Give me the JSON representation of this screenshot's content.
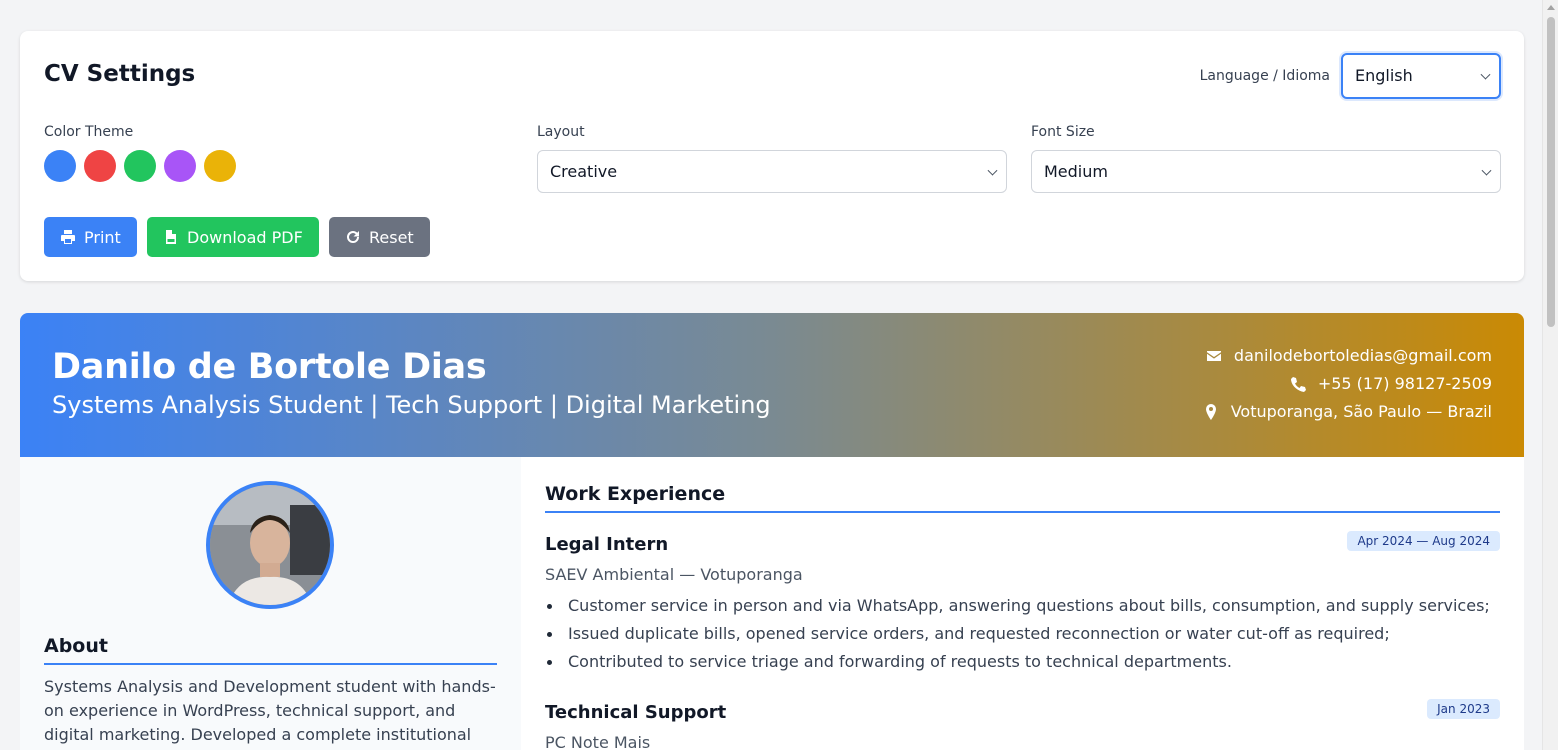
{
  "settings": {
    "title": "CV Settings",
    "language_label": "Language / Idioma",
    "language_value": "English",
    "color_theme_label": "Color Theme",
    "theme_colors": [
      "#3b82f6",
      "#ef4444",
      "#22c55e",
      "#a855f7",
      "#eab308"
    ],
    "layout_label": "Layout",
    "layout_value": "Creative",
    "font_size_label": "Font Size",
    "font_size_value": "Medium",
    "buttons": {
      "print": "Print",
      "download": "Download PDF",
      "reset": "Reset"
    },
    "button_colors": {
      "print": "#3b82f6",
      "download": "#22c55e",
      "reset": "#6b7280"
    }
  },
  "cv": {
    "name": "Danilo de Bortole Dias",
    "headline": "Systems Analysis Student | Tech Support | Digital Marketing",
    "contact": {
      "email": "danilodebortoledias@gmail.com",
      "phone": "+55 (17) 98127-2509",
      "location": "Votuporanga, São Paulo — Brazil"
    },
    "about": {
      "title": "About",
      "text": "Systems Analysis and Development student with hands-on experience in WordPress, technical support, and digital marketing. Developed a complete institutional"
    },
    "experience": {
      "title": "Work Experience",
      "jobs": [
        {
          "title": "Legal Intern",
          "date": "Apr 2024 — Aug 2024",
          "company": "SAEV Ambiental — Votuporanga",
          "bullets": [
            "Customer service in person and via WhatsApp, answering questions about bills, consumption, and supply services;",
            "Issued duplicate bills, opened service orders, and requested reconnection or water cut-off as required;",
            "Contributed to service triage and forwarding of requests to technical departments."
          ]
        },
        {
          "title": "Technical Support",
          "date": "Jan 2023",
          "company": "PC Note Mais",
          "bullets": []
        }
      ]
    }
  }
}
